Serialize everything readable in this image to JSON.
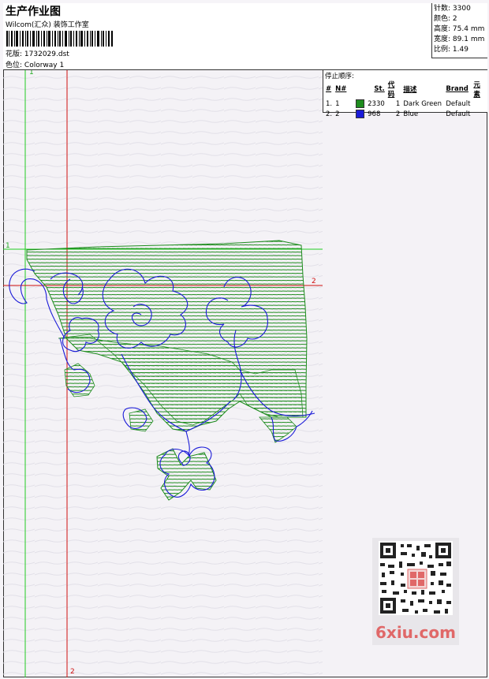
{
  "header": {
    "title": "生产作业图",
    "company": "Wilcom(汇众) 装饰工作室",
    "pattern_label": "花版:",
    "pattern_value": "1732029.dst",
    "colorway_label": "色位:",
    "colorway_value": "Colorway 1"
  },
  "stats": [
    {
      "label": "针数:",
      "value": "3300"
    },
    {
      "label": "颜色:",
      "value": "2"
    },
    {
      "label": "高度:",
      "value": "75.4 mm"
    },
    {
      "label": "宽度:",
      "value": "89.1 mm"
    },
    {
      "label": "比例:",
      "value": "1.49"
    }
  ],
  "stop_sequence": {
    "title": "停止顺序:",
    "headers": [
      "#",
      "N#",
      "St.",
      "代码",
      "描述",
      "Brand",
      "元素"
    ],
    "rows": [
      {
        "index": "1.",
        "n": "1",
        "swatch": "#1e8c1e",
        "stitches": "2330",
        "code": "1",
        "description": "Dark Green",
        "brand": "Default",
        "element": ""
      },
      {
        "index": "2.",
        "n": "2",
        "swatch": "#1a1ad8",
        "stitches": "968",
        "code": "2",
        "description": "Blue",
        "brand": "Default",
        "element": ""
      }
    ]
  },
  "guides": {
    "v1": "1",
    "h1": "1",
    "h2": "2",
    "v2": "2"
  },
  "colors": {
    "green": "#1e8c1e",
    "blue": "#1a1ad8",
    "guide_green": "#22cc22",
    "guide_red": "#d01010"
  },
  "watermark": "6xiu.com"
}
